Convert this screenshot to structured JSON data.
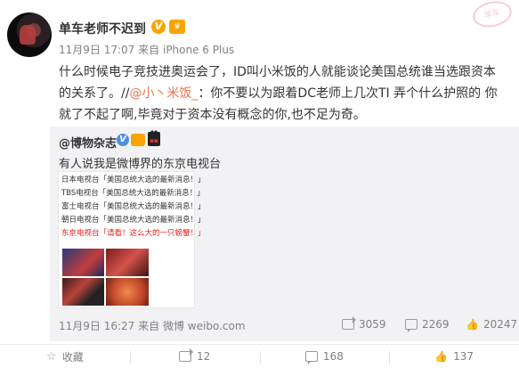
{
  "post": {
    "author": "单车老师不迟到",
    "badge_v": "V",
    "date": "11月9日 17:07",
    "source_prefix": "来自",
    "source": "iPhone 6 Plus",
    "content_part1": "什么时候电子竞技进奥运会了，ID叫小米饭的人就能谈论美国总统谁当选跟资本的关系了。//",
    "content_mention": "@小丶米饭_",
    "content_part2": "：你不要以为跟着DC老师上几次TI 弄个什么护照的 你就了不起了啊,毕竟对于资本没有概念的你,也不足为奇。"
  },
  "repost": {
    "author": "@博物杂志",
    "badge_v": "V",
    "text": "有人说我是微博界的东京电视台",
    "image_lines": [
      "日本电视台「美国总统大选的最新消息！」",
      "TBS电视台「美国总统大选的最新消息！」",
      "富士电视台「美国总统大选的最新消息！」",
      "朝日电视台「美国总统大选的最新消息！」",
      "东京电视台「请看！这么大的一只螃蟹！」"
    ],
    "time": "11月9日 16:27",
    "source_prefix": "来自",
    "source": "微博 weibo.com",
    "shares": "3059",
    "comments": "2269",
    "likes": "20247"
  },
  "actions": {
    "favorite": "收藏",
    "share": "12",
    "comment": "168",
    "like": "137"
  },
  "icons": [
    "avatar",
    "verified-icon",
    "member-hat-icon",
    "share-icon",
    "comment-icon",
    "like-icon",
    "favorite-icon"
  ],
  "colors": {
    "mention": "#eb7350",
    "repost_bg": "#f2f2f5",
    "verified_orange": "#f7a400",
    "verified_blue": "#4a90e2",
    "news_red": "#e02020"
  }
}
